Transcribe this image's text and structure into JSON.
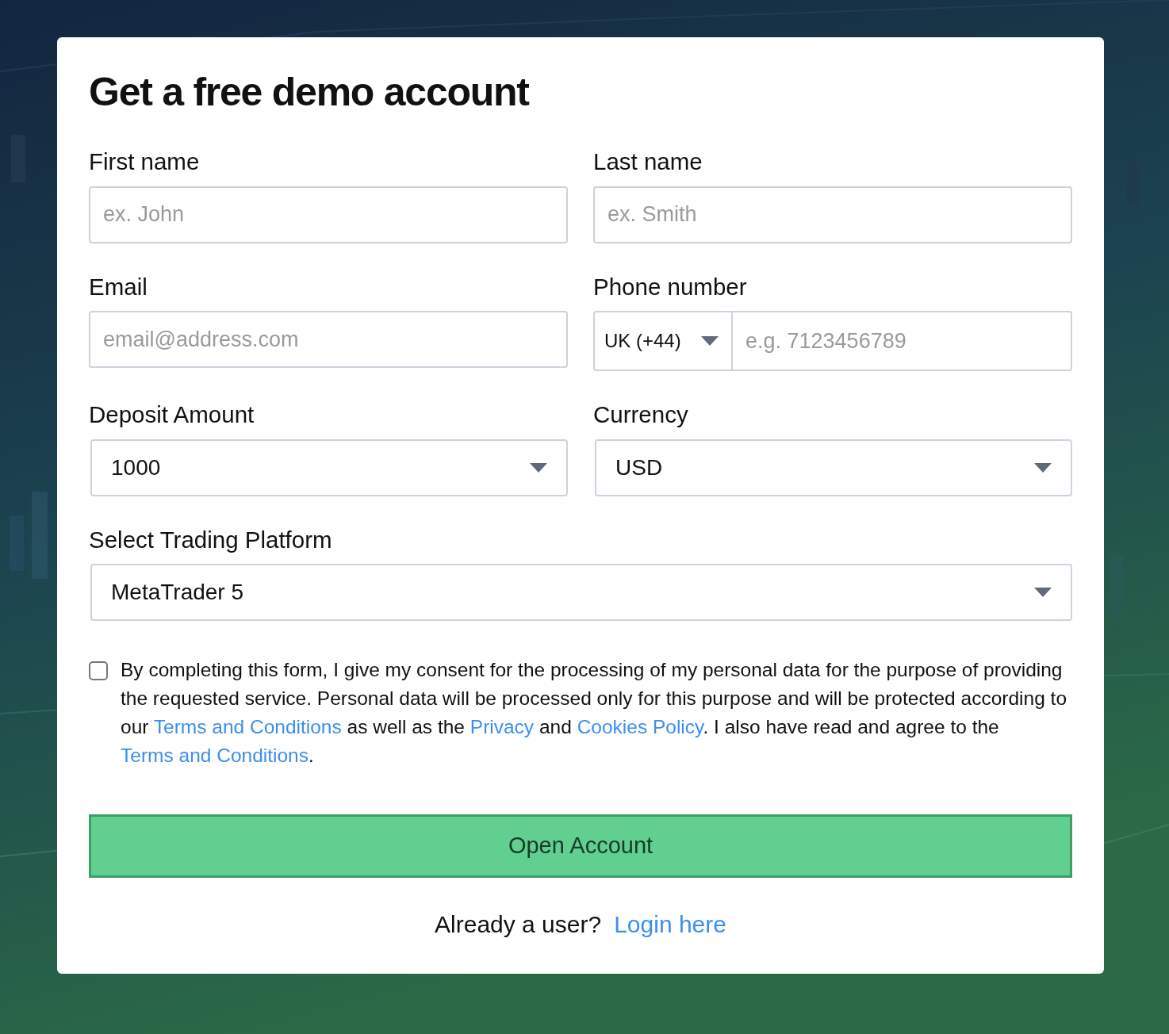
{
  "title": "Get a free demo account",
  "rows": [
    [
      {
        "kind": "text",
        "label": "First name",
        "placeholder": "ex. John"
      },
      {
        "kind": "text",
        "label": "Last name",
        "placeholder": "ex. Smith"
      }
    ],
    [
      {
        "kind": "text",
        "label": "Email",
        "placeholder": "email@address.com"
      },
      {
        "kind": "phone",
        "label": "Phone number",
        "code": "UK (+44)",
        "placeholder": "e.g. 7123456789"
      }
    ],
    [
      {
        "kind": "select",
        "label": "Deposit Amount",
        "value": "1000"
      },
      {
        "kind": "select",
        "label": "Currency",
        "value": "USD"
      }
    ],
    [
      {
        "kind": "select",
        "label": "Select Trading Platform",
        "value": "MetaTrader 5"
      }
    ]
  ],
  "consent": {
    "checked": false,
    "parts": [
      {
        "kind": "text",
        "text": "By completing this form, I give my consent for the processing of my personal data for the purpose of providing the requested service. Personal data will be processed only for this purpose and will be protected according to our "
      },
      {
        "kind": "link",
        "text": "Terms and Conditions"
      },
      {
        "kind": "text",
        "text": " as well as the "
      },
      {
        "kind": "link",
        "text": "Privacy"
      },
      {
        "kind": "text",
        "text": " and "
      },
      {
        "kind": "link",
        "text": "Cookies Policy"
      },
      {
        "kind": "text",
        "text": ". I also have read and agree to the "
      },
      {
        "kind": "link",
        "text": "Terms and Conditions"
      },
      {
        "kind": "text",
        "text": "."
      }
    ]
  },
  "submit": "Open Account",
  "footer": {
    "text": "Already a user?",
    "link": "Login here"
  }
}
